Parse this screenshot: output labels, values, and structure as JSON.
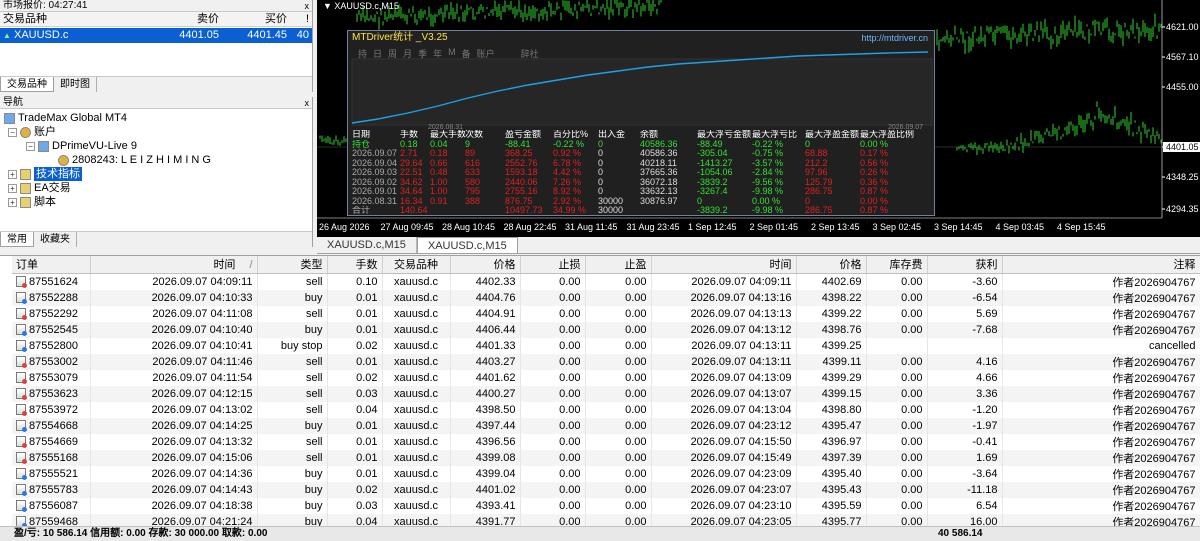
{
  "market_watch": {
    "title": "市场报价: 04:27:41",
    "close": "x",
    "headers": [
      "交易品种",
      "卖价",
      "买价",
      "!"
    ],
    "row": {
      "symbol": "XAUUSD.c",
      "bid": "4401.05",
      "ask": "4401.45",
      "spread": "40"
    },
    "tabs": [
      "交易品种",
      "即时图"
    ]
  },
  "navigator": {
    "title": "导航",
    "close": "x",
    "items": [
      "TradeMax Global MT4",
      "账户",
      "DPrimeVU-Live 9",
      "2808243: L E I Z H I M I N G",
      "技术指标",
      "EA交易",
      "脚本"
    ],
    "tabs": [
      "常用",
      "收藏夹"
    ]
  },
  "chart": {
    "title": "XAUUSD.c,M15",
    "price_labels": [
      "4621.00",
      "4567.10",
      "4455.00",
      "4401.05",
      "4348.25",
      "4294.35"
    ],
    "time_labels": [
      "26 Aug 2026",
      "27 Aug 09:45",
      "28 Aug 10:45",
      "28 Aug 22:45",
      "31 Aug 11:45",
      "31 Aug 23:45",
      "1 Sep 12:45",
      "2 Sep 01:45",
      "2 Sep 13:45",
      "3 Sep 02:45",
      "3 Sep 14:45",
      "4 Sep 03:45",
      "4 Sep 15:45"
    ],
    "tabs": [
      "XAUUSD.c,M15",
      "XAUUSD.c,M15"
    ]
  },
  "mtdriver": {
    "title": "MTDriver统计 _V3.25",
    "url": "http://mtdriver.cn",
    "menu": [
      "持",
      "日",
      "周",
      "月",
      "季",
      "年",
      "M",
      "备",
      "账户",
      "辞社"
    ],
    "date_left": "2026.08.31",
    "date_right": "2026.09.07",
    "headers": [
      "日期",
      "手数",
      "最大手数",
      "次数",
      "盈亏金额",
      "百分比%",
      "出入金",
      "余额",
      "最大浮亏金额",
      "最大浮亏比",
      "最大浮盈金额",
      "最大浮盈比例"
    ],
    "rows": [
      [
        "持仓",
        "0.18",
        "0.04",
        "9",
        "-88.41",
        "-0.22 %",
        "0",
        "40586.36",
        "-88.49",
        "-0.22 %",
        "0",
        "0.00 %"
      ],
      [
        "2026.09.07",
        "2.71",
        "0.18",
        "89",
        "368.25",
        "0.92 %",
        "0",
        "40586.36",
        "-305.04",
        "-0.75 %",
        "68.88",
        "0.17 %"
      ],
      [
        "2026.09.04",
        "29.64",
        "0.66",
        "616",
        "2552.76",
        "6.78 %",
        "0",
        "40218.11",
        "-1413.27",
        "-3.57 %",
        "212.2",
        "0.56 %"
      ],
      [
        "2026.09.03",
        "22.51",
        "0.48",
        "633",
        "1593.18",
        "4.42 %",
        "0",
        "37665.36",
        "-1054.06",
        "-2.84 %",
        "97.96",
        "0.26 %"
      ],
      [
        "2026.09.02",
        "34.62",
        "1.00",
        "580",
        "2440.06",
        "7.26 %",
        "0",
        "36072.18",
        "-3839.2",
        "-9.56 %",
        "125.79",
        "0.36 %"
      ],
      [
        "2026.09.01",
        "34.64",
        "1.00",
        "795",
        "2755.16",
        "8.92 %",
        "0",
        "33632.13",
        "-3267.4",
        "-9.98 %",
        "286.75",
        "0.87 %"
      ],
      [
        "2026.08.31",
        "16.34",
        "0.91",
        "388",
        "876.75",
        "2.92 %",
        "30000",
        "30876.97",
        "0",
        "0.00 %",
        "0",
        "0.00 %"
      ],
      [
        "合计",
        "140.64",
        "",
        "",
        "10497.73",
        "34.99 %",
        "30000",
        "",
        "-3839.2",
        "-9.98 %",
        "286.75",
        "0.87 %"
      ]
    ]
  },
  "orders": {
    "headers": [
      "订单",
      "时间",
      "类型",
      "手数",
      "交易品种",
      "价格",
      "止损",
      "止盈",
      "时间",
      "价格",
      "库存费",
      "获利",
      "注释"
    ],
    "sort_mark": "/",
    "rows": [
      [
        "87551624",
        "2026.09.07 04:09:11",
        "sell",
        "0.10",
        "xauusd.c",
        "4402.33",
        "0.00",
        "0.00",
        "2026.09.07 04:09:11",
        "4402.69",
        "0.00",
        "-3.60",
        "作者2026904767"
      ],
      [
        "87552288",
        "2026.09.07 04:10:33",
        "buy",
        "0.01",
        "xauusd.c",
        "4404.76",
        "0.00",
        "0.00",
        "2026.09.07 04:13:16",
        "4398.22",
        "0.00",
        "-6.54",
        "作者2026904767"
      ],
      [
        "87552292",
        "2026.09.07 04:11:08",
        "sell",
        "0.01",
        "xauusd.c",
        "4404.91",
        "0.00",
        "0.00",
        "2026.09.07 04:13:13",
        "4399.22",
        "0.00",
        "5.69",
        "作者2026904767"
      ],
      [
        "87552545",
        "2026.09.07 04:10:40",
        "buy",
        "0.01",
        "xauusd.c",
        "4406.44",
        "0.00",
        "0.00",
        "2026.09.07 04:13:12",
        "4398.76",
        "0.00",
        "-7.68",
        "作者2026904767"
      ],
      [
        "87552800",
        "2026.09.07 04:10:41",
        "buy stop",
        "0.02",
        "xauusd.c",
        "4401.33",
        "0.00",
        "0.00",
        "2026.09.07 04:13:11",
        "4399.25",
        "",
        "",
        "cancelled"
      ],
      [
        "87553002",
        "2026.09.07 04:11:46",
        "sell",
        "0.01",
        "xauusd.c",
        "4403.27",
        "0.00",
        "0.00",
        "2026.09.07 04:13:11",
        "4399.11",
        "0.00",
        "4.16",
        "作者2026904767"
      ],
      [
        "87553079",
        "2026.09.07 04:11:54",
        "sell",
        "0.02",
        "xauusd.c",
        "4401.62",
        "0.00",
        "0.00",
        "2026.09.07 04:13:09",
        "4399.29",
        "0.00",
        "4.66",
        "作者2026904767"
      ],
      [
        "87553623",
        "2026.09.07 04:12:15",
        "sell",
        "0.03",
        "xauusd.c",
        "4400.27",
        "0.00",
        "0.00",
        "2026.09.07 04:13:07",
        "4399.15",
        "0.00",
        "3.36",
        "作者2026904767"
      ],
      [
        "87553972",
        "2026.09.07 04:13:02",
        "sell",
        "0.04",
        "xauusd.c",
        "4398.50",
        "0.00",
        "0.00",
        "2026.09.07 04:13:04",
        "4398.80",
        "0.00",
        "-1.20",
        "作者2026904767"
      ],
      [
        "87554668",
        "2026.09.07 04:14:25",
        "buy",
        "0.01",
        "xauusd.c",
        "4397.44",
        "0.00",
        "0.00",
        "2026.09.07 04:23:12",
        "4395.47",
        "0.00",
        "-1.97",
        "作者2026904767"
      ],
      [
        "87554669",
        "2026.09.07 04:13:32",
        "sell",
        "0.01",
        "xauusd.c",
        "4396.56",
        "0.00",
        "0.00",
        "2026.09.07 04:15:50",
        "4396.97",
        "0.00",
        "-0.41",
        "作者2026904767"
      ],
      [
        "87555168",
        "2026.09.07 04:15:06",
        "sell",
        "0.01",
        "xauusd.c",
        "4399.08",
        "0.00",
        "0.00",
        "2026.09.07 04:15:49",
        "4397.39",
        "0.00",
        "1.69",
        "作者2026904767"
      ],
      [
        "87555521",
        "2026.09.07 04:14:36",
        "buy",
        "0.01",
        "xauusd.c",
        "4399.04",
        "0.00",
        "0.00",
        "2026.09.07 04:23:09",
        "4395.40",
        "0.00",
        "-3.64",
        "作者2026904767"
      ],
      [
        "87555783",
        "2026.09.07 04:14:43",
        "buy",
        "0.02",
        "xauusd.c",
        "4401.02",
        "0.00",
        "0.00",
        "2026.09.07 04:23:07",
        "4395.43",
        "0.00",
        "-11.18",
        "作者2026904767"
      ],
      [
        "87556087",
        "2026.09.07 04:18:38",
        "buy",
        "0.03",
        "xauusd.c",
        "4393.41",
        "0.00",
        "0.00",
        "2026.09.07 04:23:10",
        "4395.59",
        "0.00",
        "6.54",
        "作者2026904767"
      ],
      [
        "87559468",
        "2026.09.07 04:21:24",
        "buy",
        "0.04",
        "xauusd.c",
        "4391.77",
        "0.00",
        "0.00",
        "2026.09.07 04:23:05",
        "4395.77",
        "0.00",
        "16.00",
        "作者2026904767"
      ]
    ],
    "footer_left": "盈/亏: 10 586.14  信用额: 0.00  存款: 30 000.00  取款: 0.00",
    "footer_total": "40 586.14"
  }
}
